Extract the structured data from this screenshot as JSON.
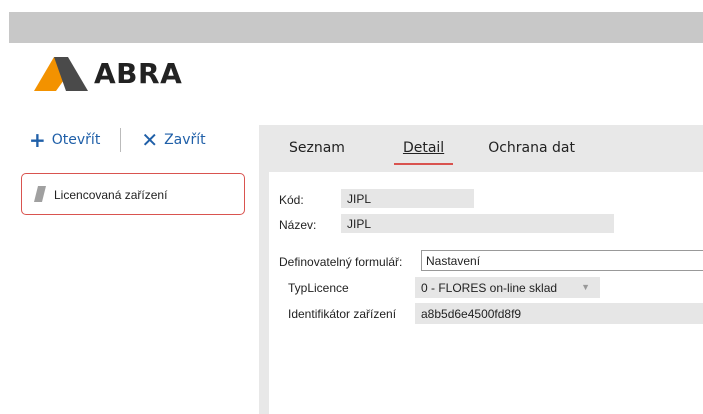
{
  "app": {
    "logo_text": "ABRA",
    "brand_colors": {
      "logo_orange": "#f39200",
      "logo_dark": "#4a4a4a",
      "accent_red": "#d9534f",
      "link_blue": "#1f5fa8"
    }
  },
  "left_toolbar": {
    "open_label": "Otevřít",
    "close_label": "Zavřít",
    "open_icon": "plus-icon",
    "close_icon": "close-icon"
  },
  "tree": {
    "items": [
      {
        "label": "Licencovaná zařízení",
        "icon": "slash-icon",
        "selected": true
      }
    ]
  },
  "tabs": [
    {
      "label": "Seznam",
      "active": false
    },
    {
      "label": "Detail",
      "active": true
    },
    {
      "label": "Ochrana dat",
      "active": false
    }
  ],
  "form": {
    "kod_label": "Kód:",
    "kod_value": "JIPL",
    "nazev_label": "Název:",
    "nazev_value": "JIPL",
    "formular_label": "Definovatelný formulář:",
    "formular_value": "Nastavení",
    "typ_label": "TypLicence",
    "typ_value": "0 - FLORES on-line sklad",
    "ident_label": "Identifikátor zařízení",
    "ident_value": "a8b5d6e4500fd8f9"
  }
}
